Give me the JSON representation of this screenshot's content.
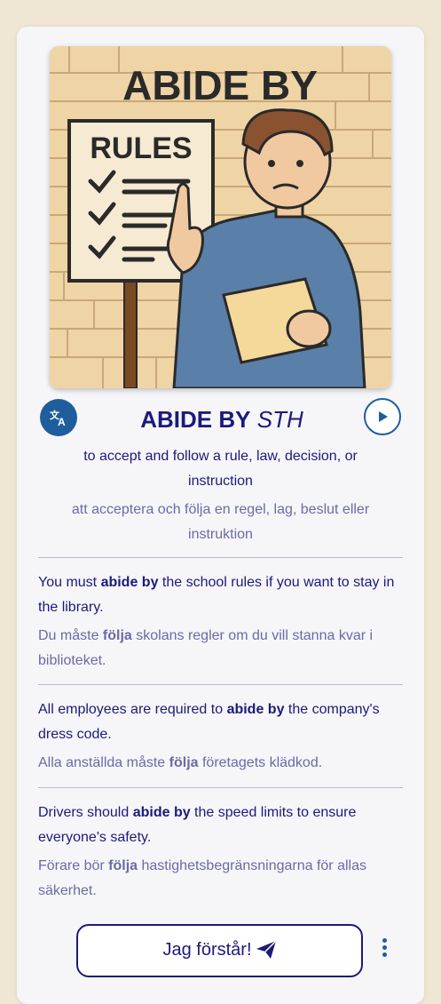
{
  "card": {
    "image": {
      "banner_text": "ABIDE BY",
      "sign_text": "RULES"
    },
    "headword": {
      "word": "ABIDE BY",
      "object": "STH"
    },
    "definition_en": "to accept and follow a rule, law, decision, or instruction",
    "definition_sv": "att acceptera och följa en regel, lag, beslut eller instruktion",
    "examples": [
      {
        "en": {
          "before": "You must ",
          "bold": "abide by",
          "after": " the school rules if you want to stay in the library."
        },
        "sv": {
          "before": "Du måste ",
          "bold": "följa",
          "after": " skolans regler om du vill stanna kvar i biblioteket."
        }
      },
      {
        "en": {
          "before": "All employees are required to ",
          "bold": "abide by",
          "after": " the company's dress code."
        },
        "sv": {
          "before": "Alla anställda måste ",
          "bold": "följa",
          "after": " företagets klädkod."
        }
      },
      {
        "en": {
          "before": "Drivers should ",
          "bold": "abide by",
          "after": " the speed limits to ensure everyone's safety."
        },
        "sv": {
          "before": "Förare bör ",
          "bold": "följa",
          "after": " hastighetsbegränsningarna för allas säkerhet."
        }
      }
    ],
    "understand_button": "Jag förstår!",
    "icons": {
      "translate": "translate-icon",
      "play": "play-icon",
      "send": "paper-plane-icon",
      "more": "more-vertical-icon"
    }
  }
}
